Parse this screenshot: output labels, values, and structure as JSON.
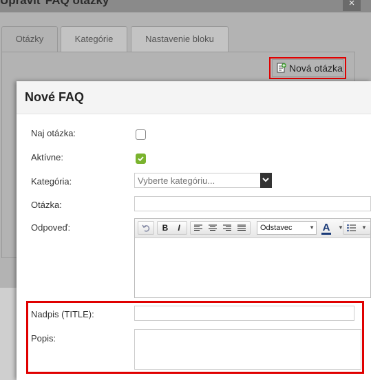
{
  "background_dialog": {
    "title": "Upraviť FAQ otázky",
    "close_glyph": "×",
    "tabs": [
      {
        "label": "Otázky",
        "active": true
      },
      {
        "label": "Kategórie",
        "active": false
      },
      {
        "label": "Nastavenie bloku",
        "active": false
      }
    ],
    "new_question_button": {
      "label": "Nová otázka",
      "icon": "add-document-icon"
    }
  },
  "modal": {
    "title": "Nové FAQ",
    "fields": {
      "top_question": {
        "label": "Naj otázka:",
        "checked": false
      },
      "active": {
        "label": "Aktívne:",
        "checked": true
      },
      "category": {
        "label": "Kategória:",
        "placeholder": "Vyberte kategóriu..."
      },
      "question": {
        "label": "Otázka:",
        "value": ""
      },
      "answer": {
        "label": "Odpoveď:",
        "toolbar": {
          "format_value": "Odstavec",
          "buttons": [
            "undo-icon",
            "bold-icon",
            "italic-icon",
            "align-left-icon",
            "align-center-icon",
            "align-right-icon",
            "align-justify-icon",
            "font-color-icon",
            "bullet-list-icon"
          ],
          "bold_glyph": "B",
          "italic_glyph": "I",
          "font_color_glyph": "A"
        }
      },
      "title": {
        "label": "Nadpis (TITLE):",
        "value": ""
      },
      "description": {
        "label": "Popis:",
        "value": ""
      }
    }
  },
  "colors": {
    "highlight": "#e00000",
    "checkbox_checked": "#7ab32e"
  }
}
